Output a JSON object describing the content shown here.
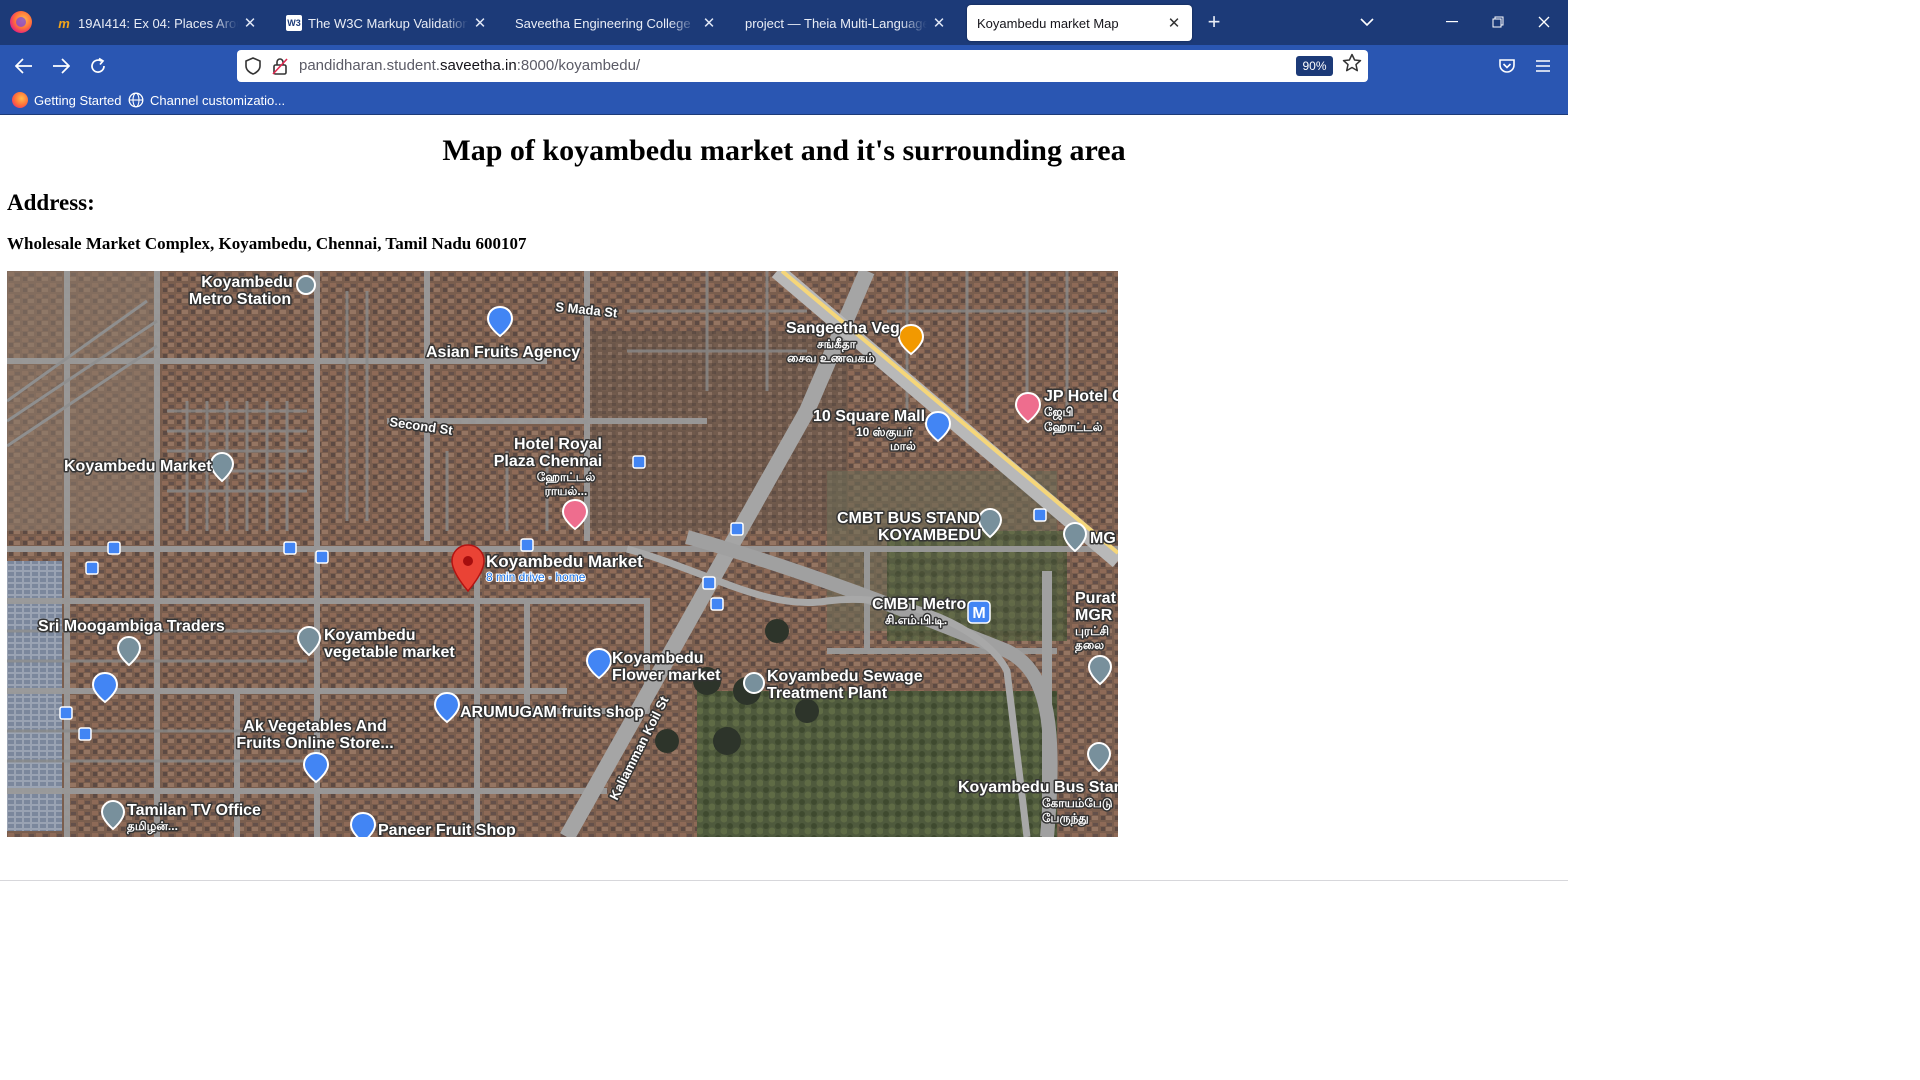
{
  "browser": {
    "tabs": [
      {
        "title": "19AI414: Ex 04: Places Around Me",
        "favicon": "moodle-icon"
      },
      {
        "title": "The W3C Markup Validation Service",
        "favicon": "w3c-icon"
      },
      {
        "title": "Saveetha Engineering College",
        "favicon": ""
      },
      {
        "title": "project — Theia Multi-Language Explorer",
        "favicon": ""
      },
      {
        "title": "Koyambedu market Map",
        "favicon": "",
        "active": true
      }
    ],
    "tab_close_symbol": "✕",
    "new_tab_symbol": "+",
    "url_prefix": "pandidharan.student.",
    "url_host": "saveetha.in",
    "url_suffix": ":8000/koyambedu/",
    "zoom": "90%",
    "bookmarks": [
      {
        "label": "Getting Started",
        "icon": "firefox-icon"
      },
      {
        "label": "Channel customizatio...",
        "icon": "globe-icon"
      }
    ]
  },
  "page": {
    "title": "Map of koyambedu market and it's surrounding area",
    "address_heading": "Address:",
    "address": "Wholesale Market Complex, Koyambedu, Chennai, Tamil Nadu 600107"
  },
  "map": {
    "main_pin_label": "Koyambedu Market",
    "main_pin_sublabel": "8 min drive · home",
    "labels": {
      "metro_station": [
        "Koyambedu",
        "Metro Station"
      ],
      "s_mada_st": "S Mada St",
      "asian_fruits": "Asian Fruits Agency",
      "sangeetha": [
        "Sangeetha Veg",
        "சங்கீதா",
        "சைவ உணவகம்"
      ],
      "jp_hotel": [
        "JP Hotel C",
        "ஜேபி",
        "ஹோட்டல்"
      ],
      "second_st": "Second St",
      "hotel_royal": [
        "Hotel Royal",
        "Plaza Chennai",
        "ஹோட்டல்",
        "ராயல்..."
      ],
      "square_mall": [
        "10 Square Mall",
        "10 ஸ்குயர்",
        "மால்"
      ],
      "koyambedu_market_left": "Koyambedu Market",
      "cmbt_bus": [
        "CMBT BUS STAND",
        "KOYAMBEDU"
      ],
      "mg": "MG",
      "cmbt_metro": [
        "CMBT Metro",
        "சி.எம்.பி.டி."
      ],
      "purat": [
        "Purat",
        "MGR",
        "புரட்சி",
        "தலை"
      ],
      "moogambiga": "Sri Moogambiga Traders",
      "veg_market": [
        "Koyambedu",
        "vegetable market"
      ],
      "flower_market": [
        "Koyambedu",
        "Flower market"
      ],
      "sewage": [
        "Koyambedu Sewage",
        "Treatment Plant"
      ],
      "arumugam": "ARUMUGAM fruits shop",
      "ak_veg": [
        "Ak Vegetables And",
        "Fruits Online Store..."
      ],
      "kaliamman": "Kaliamman Koil St",
      "tamilan": [
        "Tamilan TV Office",
        "தமிழன்..."
      ],
      "paneer": "Paneer Fruit Shop",
      "bus_stand_right": [
        "Koyambedu Bus Stan",
        "கோயம்பேடு",
        "பேருந்து"
      ],
      "metro_m": "M"
    },
    "colors": {
      "pin_red": "#ea4335",
      "poi_blue": "#4285f4",
      "poi_grey": "#78909c",
      "poi_orange": "#f29900",
      "poi_pink": "#ee6d8e",
      "highway": "#f5d67a"
    }
  }
}
